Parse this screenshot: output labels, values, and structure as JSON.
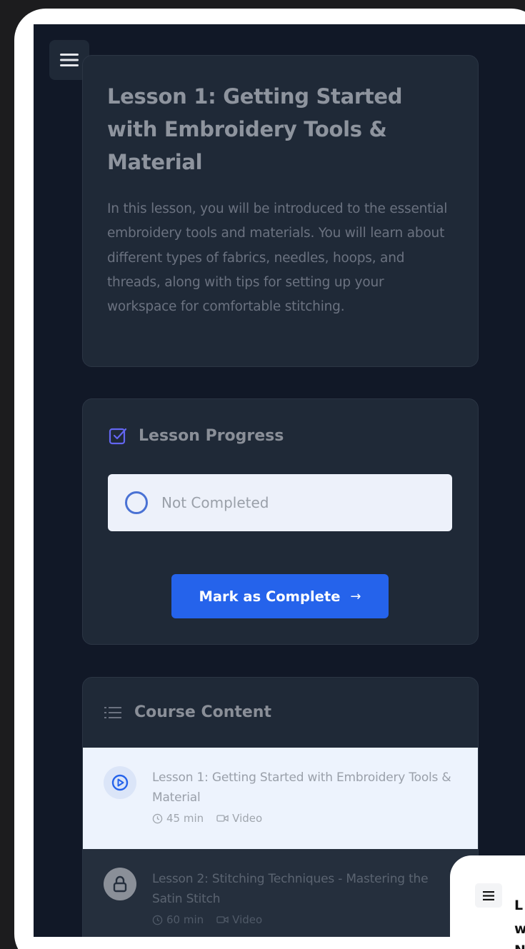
{
  "lesson": {
    "title": "Lesson 1: Getting Started with Embroidery Tools & Material",
    "description": "In this lesson, you will be introduced to the essential embroidery tools and materials. You will learn about different types of fabrics, needles, hoops, and threads, along with tips for setting up your workspace for comfortable stitching."
  },
  "progress": {
    "title": "Lesson Progress",
    "status": "Not Completed",
    "button_label": "Mark as Complete",
    "button_arrow": "→"
  },
  "content": {
    "title": "Course Content",
    "lessons": [
      {
        "title": "Lesson 1: Getting Started with Embroidery Tools & Material",
        "duration": "45 min",
        "type": "Video",
        "icon": "play-circle-icon",
        "state": "active"
      },
      {
        "title": "Lesson 2: Stitching Techniques - Mastering the Satin Stitch",
        "duration": "60 min",
        "type": "Video",
        "icon": "lock-icon",
        "state": "locked"
      }
    ]
  },
  "overlay": {
    "letters": [
      "L",
      "w",
      "N"
    ]
  },
  "colors": {
    "background": "#111827",
    "card": "#1f2937",
    "accent": "#2563eb",
    "status_box": "#edf1fa",
    "active_row": "#edf3fd",
    "checkbox_icon": "#6366f1"
  }
}
